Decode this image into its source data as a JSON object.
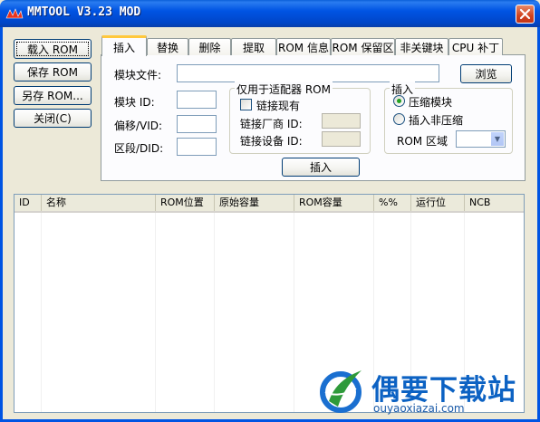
{
  "window": {
    "title": "MMTOOL V3.23 MOD"
  },
  "side_buttons": {
    "load_rom": "载入 ROM",
    "save_rom": "保存 ROM",
    "save_as": "另存 ROM...",
    "close": "关闭(C)"
  },
  "tabs": [
    "插入",
    "替换",
    "删除",
    "提取",
    "ROM 信息",
    "ROM 保留区",
    "非关键块",
    "CPU 补丁"
  ],
  "insert_panel": {
    "module_file_label": "模块文件:",
    "browse_button": "浏览",
    "module_id_label": "模块 ID:",
    "offset_vid_label": "偏移/VID:",
    "segment_did_label": "区段/DID:",
    "adapter_group_title": "仅用于适配器 ROM",
    "link_existing_label": "链接现有",
    "link_vendor_id_label": "链接厂商 ID:",
    "link_device_id_label": "链接设备 ID:",
    "insert_group_title": "插入",
    "compressed_module_label": "压缩模块",
    "insert_uncompressed_label": "插入非压缩",
    "rom_region_label": "ROM 区域",
    "insert_button": "插入"
  },
  "list_columns": [
    "ID",
    "名称",
    "ROM位置",
    "原始容量",
    "ROM容量",
    "%%",
    "运行位",
    "NCB"
  ],
  "watermark": {
    "title": "偶要下载站",
    "url": "ouyaoxiazai.com"
  },
  "colors": {
    "title_bar": "#0054e3",
    "dialog_face": "#ece9d8",
    "active_tab_accent": "#ffc83c",
    "close_button": "#d0421e",
    "watermark_blue": "#0c62c3"
  }
}
